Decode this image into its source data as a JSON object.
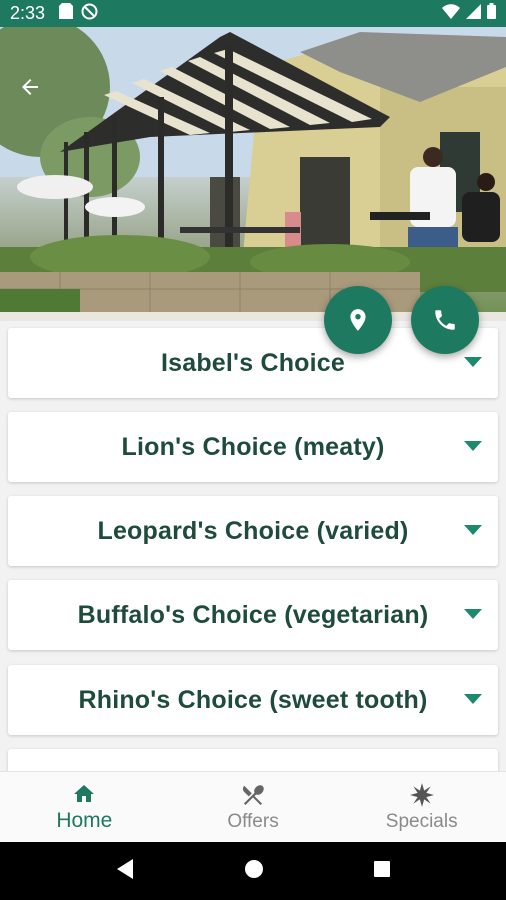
{
  "status_bar": {
    "time": "2:33",
    "left_icons": [
      "sd-card-icon",
      "no-data-icon"
    ],
    "right_icons": [
      "wifi-icon",
      "signal-icon",
      "battery-icon"
    ]
  },
  "hero": {
    "image_alt": "restaurant-terrace-photo",
    "back_icon": "arrow-left-icon"
  },
  "fabs": {
    "location_icon": "location-pin-icon",
    "phone_icon": "phone-icon"
  },
  "menu": {
    "items": [
      {
        "label": "Isabel's Choice"
      },
      {
        "label": "Lion's Choice (meaty)"
      },
      {
        "label": "Leopard's Choice (varied)"
      },
      {
        "label": "Buffalo's Choice (vegetarian)"
      },
      {
        "label": "Rhino's Choice (sweet tooth)"
      }
    ]
  },
  "bottom_nav": {
    "items": [
      {
        "label": "Home",
        "icon": "home-icon",
        "active": true
      },
      {
        "label": "Offers",
        "icon": "fork-knife-icon",
        "active": false
      },
      {
        "label": "Specials",
        "icon": "sparkle-icon",
        "active": false
      }
    ]
  },
  "colors": {
    "primary": "#1d7a60",
    "title_text": "#1e4b3c",
    "inactive": "#8a8a8a"
  }
}
